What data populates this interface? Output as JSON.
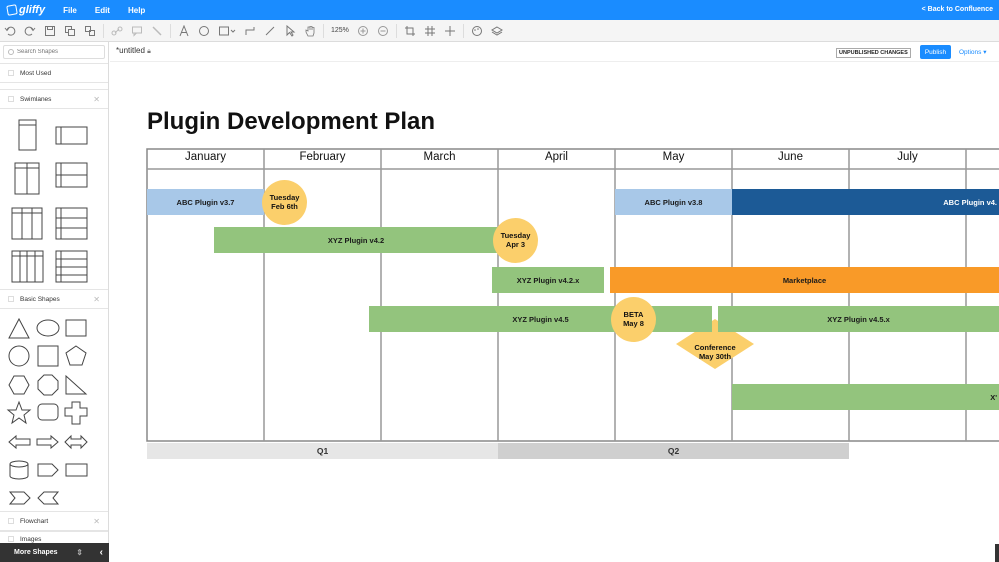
{
  "app": {
    "menu": [
      "File",
      "Edit",
      "Help"
    ],
    "back_link": "< Back to Confluence"
  },
  "toolbar": {
    "zoom": "125%"
  },
  "sidebar": {
    "search_placeholder": "Search Shapes",
    "sections": {
      "most_used": "Most Used",
      "swimlanes": "Swimlanes",
      "basic_shapes": "Basic Shapes",
      "flowchart": "Flowchart",
      "images": "Images"
    },
    "more_shapes": "More Shapes"
  },
  "document": {
    "name": "*untitled",
    "unpublished": "UNPUBLISHED CHANGES",
    "publish": "Publish",
    "options": "Options"
  },
  "diagram": {
    "title": "Plugin Development Plan",
    "months": [
      "January",
      "February",
      "March",
      "April",
      "May",
      "June",
      "July"
    ],
    "quarters": [
      "Q1",
      "Q2"
    ],
    "bars": {
      "abc37": "ABC Plugin v3.7",
      "abc38": "ABC Plugin v3.8",
      "abc4x": "ABC Plugin v4.",
      "xyz42": "XYZ Plugin v4.2",
      "xyz42x": "XYZ Plugin v4.2.x",
      "marketplace": "Marketplace",
      "xyz45": "XYZ Plugin v4.5",
      "xyz45x": "XYZ Plugin v4.5.x",
      "xy_cut": "X'"
    },
    "milestones": {
      "feb6_l1": "Tuesday",
      "feb6_l2": "Feb 6th",
      "apr3_l1": "Tuesday",
      "apr3_l2": "Apr 3",
      "beta_l1": "BETA",
      "beta_l2": "May 8",
      "conf_l1": "Conference",
      "conf_l2": "May 30th"
    },
    "colors": {
      "light_blue": "#a8c8e8",
      "dark_blue": "#1c5a96",
      "green": "#93c47d",
      "orange": "#f99a28",
      "yellow": "#fbcf6b",
      "q1_bg": "#e6e6e6",
      "q2_bg": "#cfcfcf"
    }
  }
}
